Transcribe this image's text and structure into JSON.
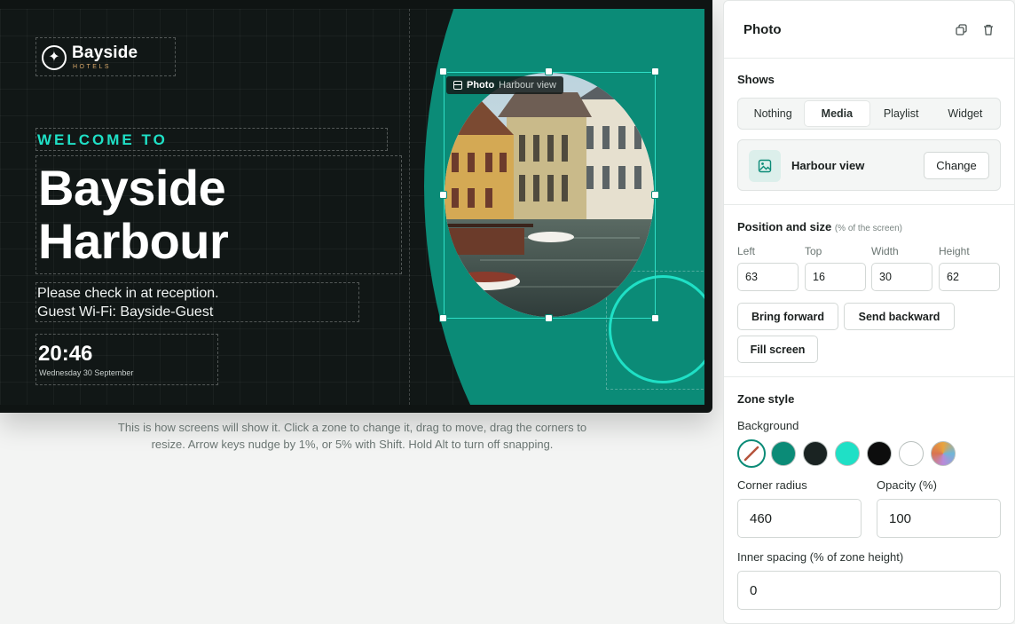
{
  "preview": {
    "logo": {
      "name": "Bayside",
      "sub": "HOTELS"
    },
    "welcome": "WELCOME TO",
    "title_line1": "Bayside",
    "title_line2": "Harbour",
    "message_line1": "Please check in at reception.",
    "message_line2": "Guest Wi-Fi: Bayside-Guest",
    "clock_time": "20:46",
    "clock_date": "Wednesday 30 September",
    "selected_tag": {
      "label": "Photo",
      "value": "Harbour view"
    },
    "colors": {
      "background": "#111716",
      "accent_teal": "#0b8b77",
      "accent_bright": "#1fe0c6"
    }
  },
  "helper_text_line1": "This is how screens will show it. Click a zone to change it, drag to move, drag the corners to",
  "helper_text_line2": "resize. Arrow keys nudge by 1%, or 5% with Shift. Hold Alt to turn off snapping.",
  "panel": {
    "title": "Photo",
    "header_icons": [
      "duplicate-icon",
      "trash-icon"
    ],
    "shows": {
      "title": "Shows",
      "options": [
        "Nothing",
        "Media",
        "Playlist",
        "Widget"
      ],
      "selected": "Media"
    },
    "media": {
      "name": "Harbour view",
      "change_label": "Change",
      "icon": "image-icon"
    },
    "position": {
      "title": "Position and size",
      "hint": "(% of the screen)",
      "left_label": "Left",
      "left": "63",
      "top_label": "Top",
      "top": "16",
      "width_label": "Width",
      "width": "30",
      "height_label": "Height",
      "height": "62",
      "bring_forward": "Bring forward",
      "send_backward": "Send backward",
      "fill_screen": "Fill screen"
    },
    "zone_style": {
      "title": "Zone style",
      "background_label": "Background",
      "swatches": [
        "none",
        "#0b8b77",
        "#1a2322",
        "#1fe0c6",
        "#0d0d0d",
        "#ffffff",
        "multicolor"
      ],
      "corner_radius_label": "Corner radius",
      "corner_radius": "460",
      "opacity_label": "Opacity (%)",
      "opacity": "100",
      "inner_spacing_label": "Inner spacing (% of zone height)",
      "inner_spacing": "0"
    }
  }
}
